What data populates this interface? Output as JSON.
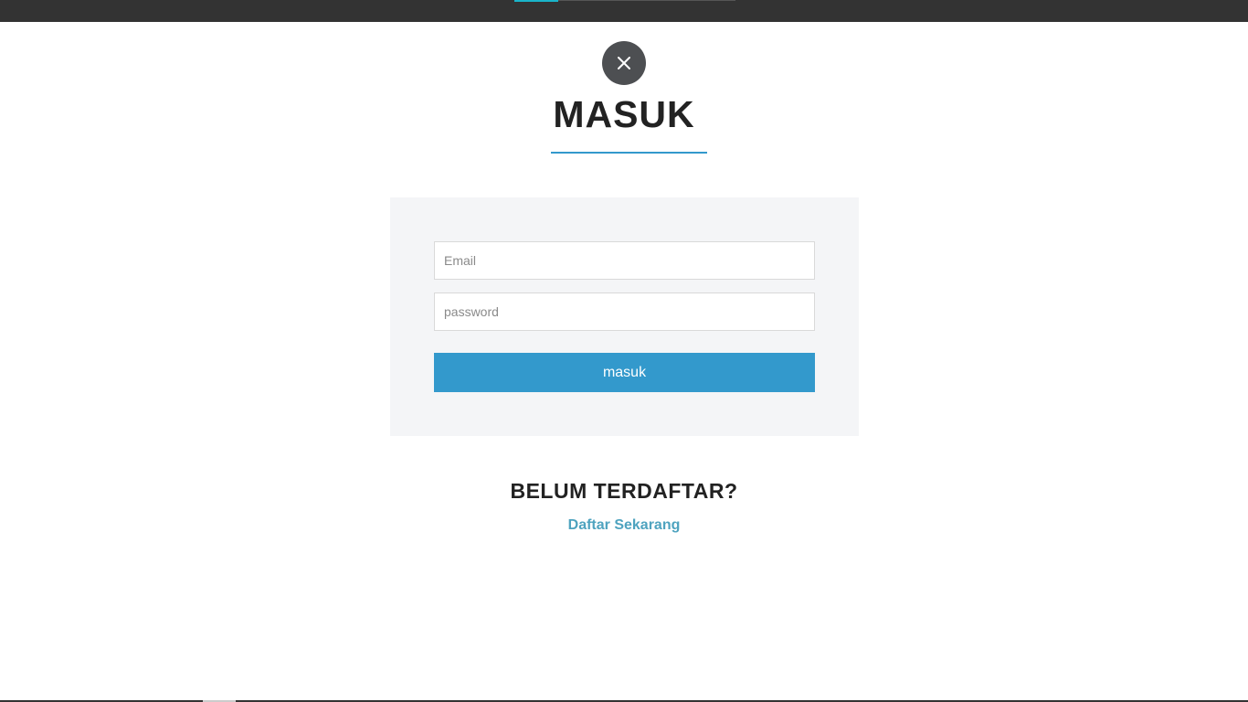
{
  "header": {
    "accent_color": "#1ab4c9",
    "bar_color": "#333333"
  },
  "modal": {
    "close_icon": "close-icon",
    "title": "MASUK",
    "accent_color": "#3399cc"
  },
  "login_form": {
    "email_placeholder": "Email",
    "email_value": "",
    "password_placeholder": "password",
    "password_value": "",
    "submit_label": "masuk"
  },
  "register": {
    "heading": "BELUM TERDAFTAR?",
    "link_label": "Daftar Sekarang",
    "link_color": "#4ea3bf"
  }
}
